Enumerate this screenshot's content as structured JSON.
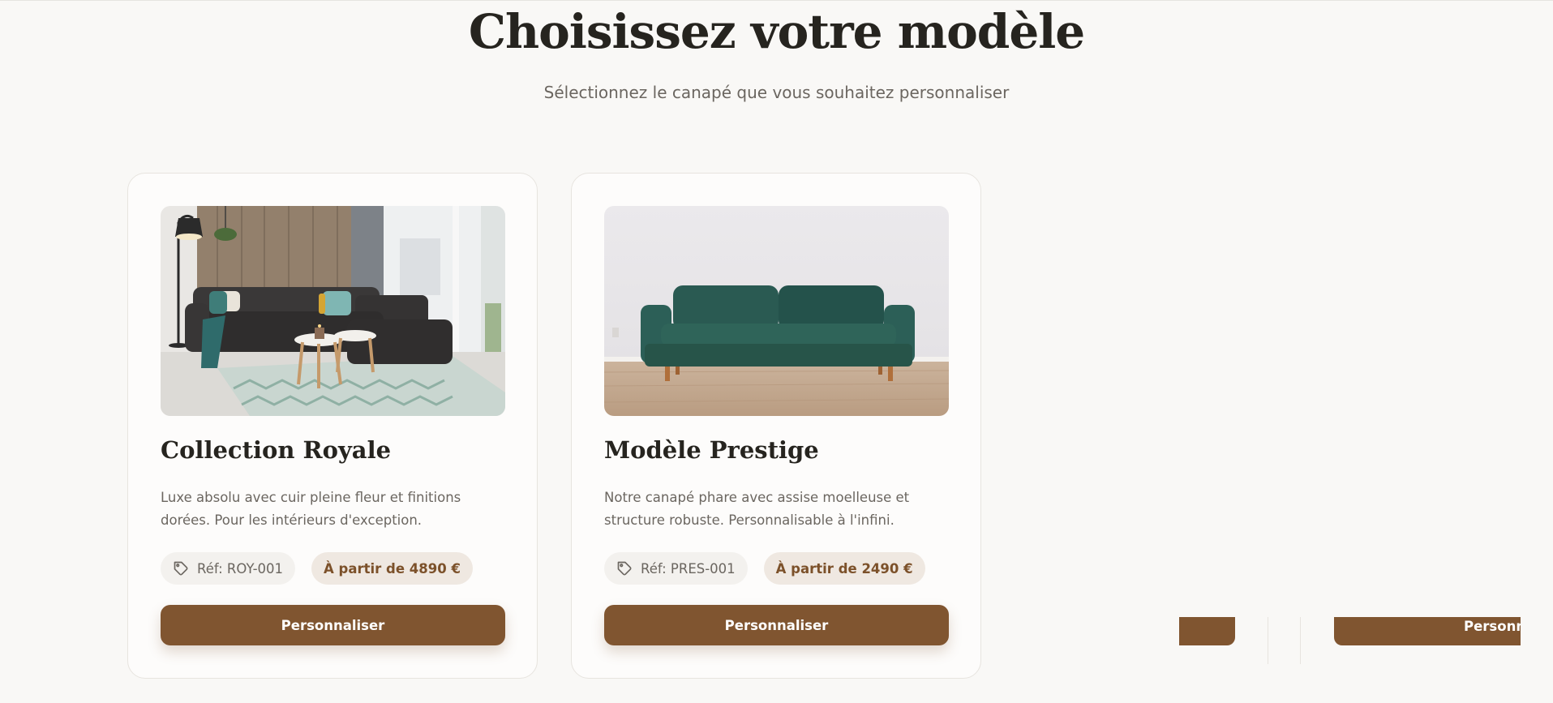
{
  "header": {
    "title": "Choisissez votre modèle",
    "subtitle": "Sélectionnez le canapé que vous souhaitez personnaliser"
  },
  "models": [
    {
      "name": "Collection Royale",
      "description": "Luxe absolu avec cuir pleine fleur et finitions dorées. Pour les intérieurs d'exception.",
      "ref": "Réf: ROY-001",
      "price": "À partir de 4890 €",
      "button": "Personnaliser",
      "image": "dark-grey-corner-sofa-living-room"
    },
    {
      "name": "Modèle Prestige",
      "description": "Notre canapé phare avec assise moelleuse et structure robuste. Personnalisable à l'infini.",
      "ref": "Réf: PRES-001",
      "price": "À partir de 2490 €",
      "button": "Personnaliser",
      "image": "green-velvet-sofa"
    }
  ],
  "offscreen_button_fragment": "Personna",
  "icons": {
    "ref_chip": "tag-icon"
  },
  "colors": {
    "accent": "#805530",
    "background": "#f9f8f6",
    "card": "#fdfcfb",
    "price_chip_bg": "#efe8e1",
    "price_text": "#7c512a"
  }
}
